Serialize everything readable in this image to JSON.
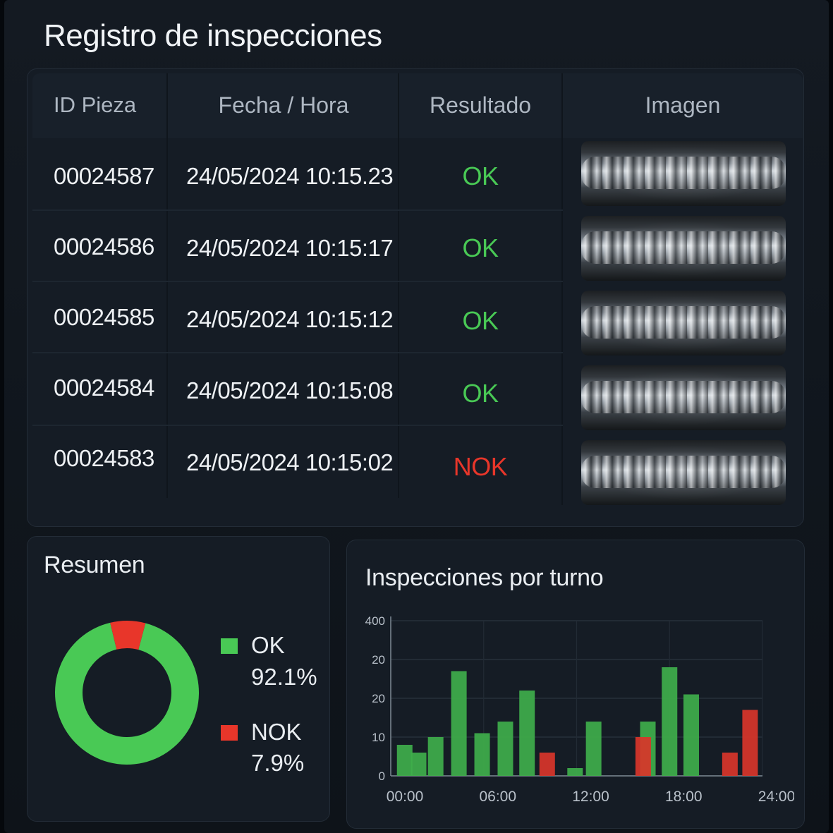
{
  "page": {
    "title": "Registro de inspecciones"
  },
  "table": {
    "headers": [
      "ID Pieza",
      "Fecha / Hora",
      "Resultado",
      "Imagen"
    ],
    "rows": [
      {
        "id": "00024587",
        "datetime": "24/05/2024 10:15.23",
        "result": "OK"
      },
      {
        "id": "00024586",
        "datetime": "24/05/2024 10:15:17",
        "result": "OK"
      },
      {
        "id": "00024585",
        "datetime": "24/05/2024 10:15:12",
        "result": "OK"
      },
      {
        "id": "00024584",
        "datetime": "24/05/2024 10:15:08",
        "result": "OK"
      },
      {
        "id": "00024583",
        "datetime": "24/05/2024 10:15:02",
        "result": "NOK"
      }
    ]
  },
  "summary": {
    "title": "Resumen",
    "ok_label": "OK",
    "ok_pct": "92.1%",
    "nok_label": "NOK",
    "nok_pct": "7.9%"
  },
  "colors": {
    "ok": "#49c955",
    "nok": "#e8362a",
    "bar_ok": "#3fae4b",
    "bar_nok": "#d9352a"
  },
  "chart_data": {
    "type": "bar",
    "title": "Inspecciones por turno",
    "y_tick_labels": [
      "0",
      "10",
      "20",
      "20",
      "400"
    ],
    "x_tick_labels": [
      "00:00",
      "06:00",
      "12:00",
      "18:00",
      "24:00"
    ],
    "xlim": [
      0,
      24
    ],
    "ylim": [
      0,
      40
    ],
    "grid": true,
    "series": [
      {
        "status": "ok",
        "x": [
          0.9,
          1.8,
          2.9,
          4.4,
          5.9,
          7.4,
          8.8,
          11.9,
          13.1,
          16.6,
          18.0,
          19.4
        ],
        "values": [
          8,
          6,
          10,
          27,
          11,
          14,
          22,
          2,
          14,
          14,
          28,
          21
        ]
      },
      {
        "status": "nok",
        "x": [
          10.1,
          16.3,
          21.9,
          23.2
        ],
        "values": [
          6,
          10,
          6,
          17
        ]
      }
    ],
    "pie": {
      "ok": 92.1,
      "nok": 7.9
    }
  }
}
